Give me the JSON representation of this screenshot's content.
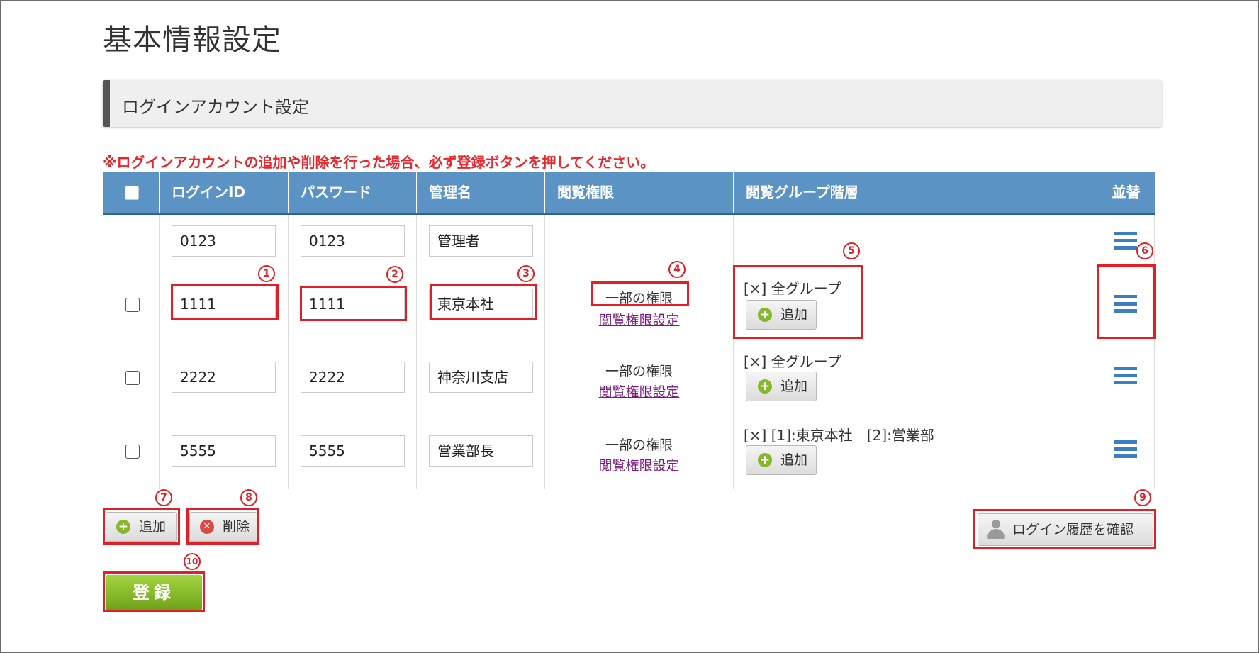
{
  "page_title": "基本情報設定",
  "section_title": "ログインアカウント設定",
  "notice": "※ログインアカウントの追加や削除を行った場合、必ず登録ボタンを押してください。",
  "table": {
    "headers": [
      "ログインID",
      "パスワード",
      "管理名",
      "閲覧権限",
      "閲覧グループ階層",
      "並替"
    ],
    "rows": [
      {
        "login_id": "0123",
        "password": "0123",
        "name": "管理者",
        "permission": "",
        "permission_link": "",
        "group": "",
        "group_add": ""
      },
      {
        "login_id": "1111",
        "password": "1111",
        "name": "東京本社",
        "permission": "一部の権限",
        "permission_link": "閲覧権限設定",
        "group": "[×] 全グループ",
        "group_add": "追加"
      },
      {
        "login_id": "2222",
        "password": "2222",
        "name": "神奈川支店",
        "permission": "一部の権限",
        "permission_link": "閲覧権限設定",
        "group": "[×] 全グループ",
        "group_add": "追加"
      },
      {
        "login_id": "5555",
        "password": "5555",
        "name": "営業部長",
        "permission": "一部の権限",
        "permission_link": "閲覧権限設定",
        "group": "[×] [1]:東京本社　[2]:営業部",
        "group_add": "追加"
      }
    ]
  },
  "buttons": {
    "add": "追加",
    "delete": "削除",
    "login_history": "ログイン履歴を確認",
    "register": "登録"
  },
  "callouts": [
    "1",
    "2",
    "3",
    "4",
    "5",
    "6",
    "7",
    "8",
    "9",
    "10"
  ],
  "colors": {
    "header_blue": "#5b94c4",
    "highlight_red": "#e21f26",
    "register_green": "#86b72d",
    "link_purple": "#7b1a7e"
  }
}
